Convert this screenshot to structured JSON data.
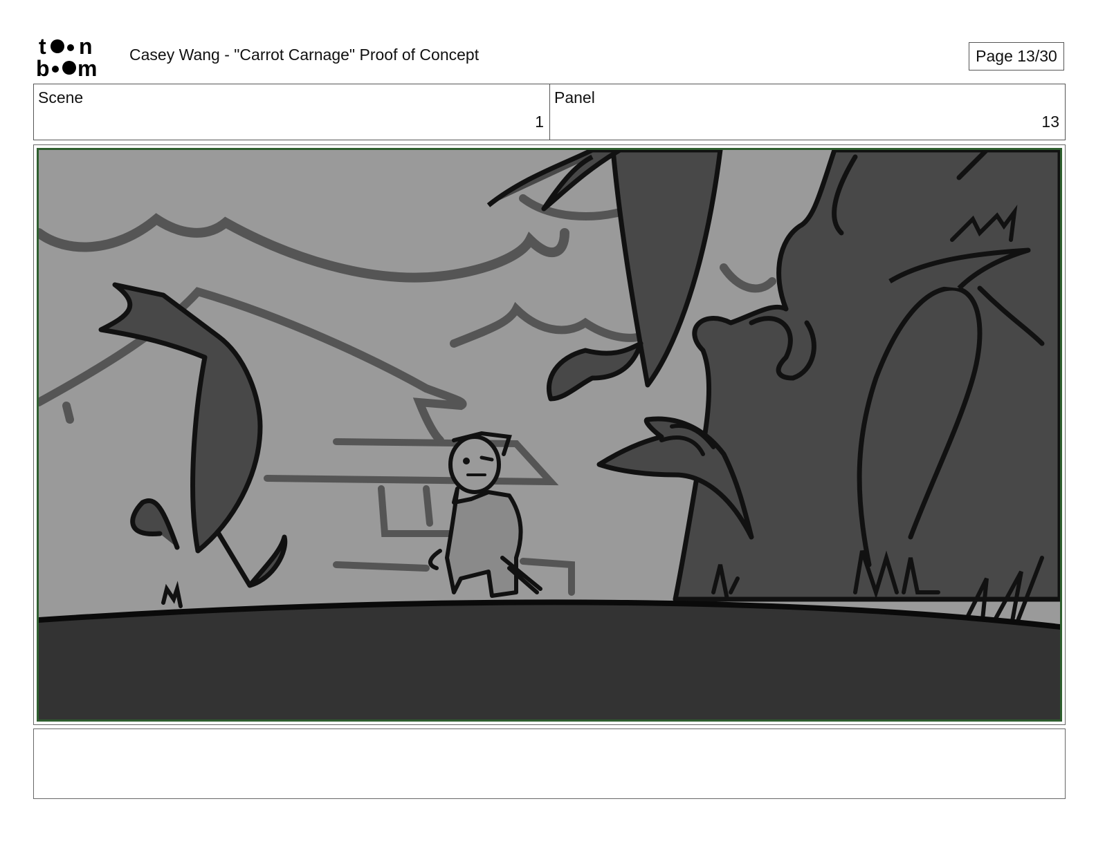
{
  "header": {
    "logo_text": "toon boom",
    "title": "Casey Wang - \"Carrot Carnage\" Proof of Concept",
    "page_label": "Page 13/30"
  },
  "info": {
    "scene_label": "Scene",
    "scene_value": "1",
    "panel_label": "Panel",
    "panel_value": "13"
  },
  "artwork": {
    "frame_color": "#2e5e2e",
    "sky_color": "#9a9a9a",
    "ground_color": "#333333",
    "tree_color": "#484848"
  },
  "notes": {
    "text": ""
  }
}
